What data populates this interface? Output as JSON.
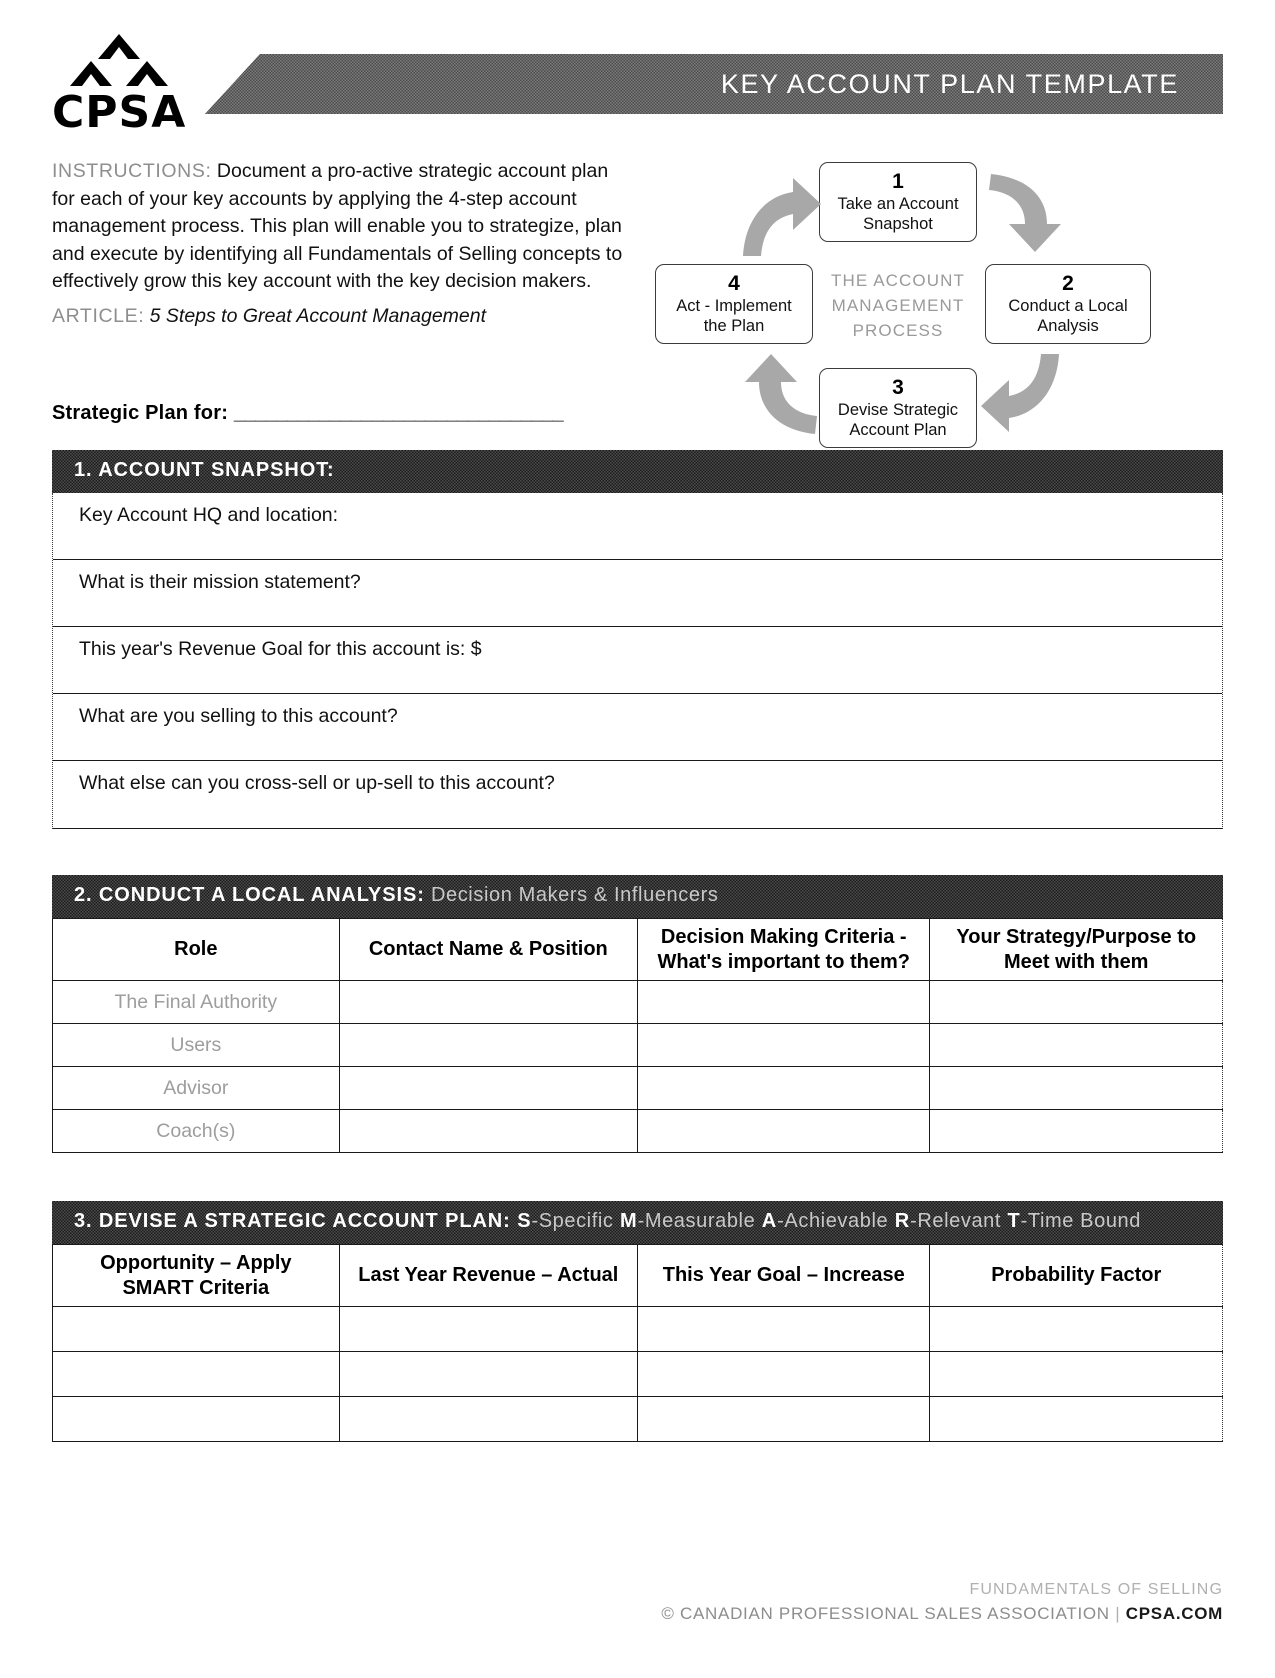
{
  "header": {
    "logo_text": "CPSA",
    "banner_title": "KEY ACCOUNT PLAN TEMPLATE"
  },
  "intro": {
    "instructions_label": "INSTRUCTIONS:",
    "instructions_body": " Document a pro-active strategic account plan for each of your key accounts by applying the 4-step account management process. This plan will enable you to strategize, plan and execute by identifying all Fundamentals of Selling concepts to effectively grow this key account with the key decision makers.",
    "article_label": "ARTICLE:",
    "article_title": "5 Steps to Great Account Management",
    "plan_for_label": "Strategic Plan for:",
    "plan_for_rule": "_______________________________"
  },
  "diagram": {
    "center_line1": "THE ACCOUNT",
    "center_line2": "MANAGEMENT",
    "center_line3": "PROCESS",
    "steps": [
      {
        "num": "1",
        "line1": "Take an Account",
        "line2": "Snapshot"
      },
      {
        "num": "2",
        "line1": "Conduct a Local",
        "line2": "Analysis"
      },
      {
        "num": "3",
        "line1": "Devise Strategic",
        "line2": "Account Plan"
      },
      {
        "num": "4",
        "line1": "Act - Implement",
        "line2": "the Plan"
      }
    ]
  },
  "section1": {
    "heading": "1. ACCOUNT SNAPSHOT:",
    "questions": [
      "Key Account HQ and location:",
      "What is their mission statement?",
      "This year's Revenue Goal for this account is: $",
      "What are you selling to this account?",
      "What else can you cross-sell or up-sell to this account?"
    ]
  },
  "section2": {
    "heading_bold": "2. CONDUCT A LOCAL ANALYSIS:",
    "heading_soft": " Decision Makers & Influencers",
    "columns": [
      "Role",
      "Contact Name & Position",
      "Decision Making Criteria -|What's important to them?",
      "Your Strategy/Purpose to|Meet with them"
    ],
    "col0": "Role",
    "col1": "Contact Name & Position",
    "col2_line1": "Decision Making Criteria -",
    "col2_line2": "What's important to them?",
    "col3_line1": "Your Strategy/Purpose to",
    "col3_line2": "Meet with them",
    "roles": [
      "The Final Authority",
      "Users",
      "Advisor",
      "Coach(s)"
    ]
  },
  "section3": {
    "heading_bold": "3. DEVISE A STRATEGIC ACCOUNT PLAN:",
    "smart": [
      {
        "letter": "S",
        "word": "-Specific"
      },
      {
        "letter": "M",
        "word": "-Measurable"
      },
      {
        "letter": "A",
        "word": "-Achievable"
      },
      {
        "letter": "R",
        "word": "-Relevant"
      },
      {
        "letter": "T",
        "word": "-Time Bound"
      }
    ],
    "col0_line1": "Opportunity – Apply",
    "col0_line2": "SMART Criteria",
    "col1": "Last Year Revenue – Actual",
    "col2": "This Year Goal – Increase",
    "col3": "Probability Factor",
    "row_count": 3
  },
  "footer": {
    "line1": "FUNDAMENTALS OF SELLING",
    "copyright": "© CANADIAN PROFESSIONAL SALES ASSOCIATION",
    "separator": "|",
    "domain": "CPSA.COM"
  }
}
